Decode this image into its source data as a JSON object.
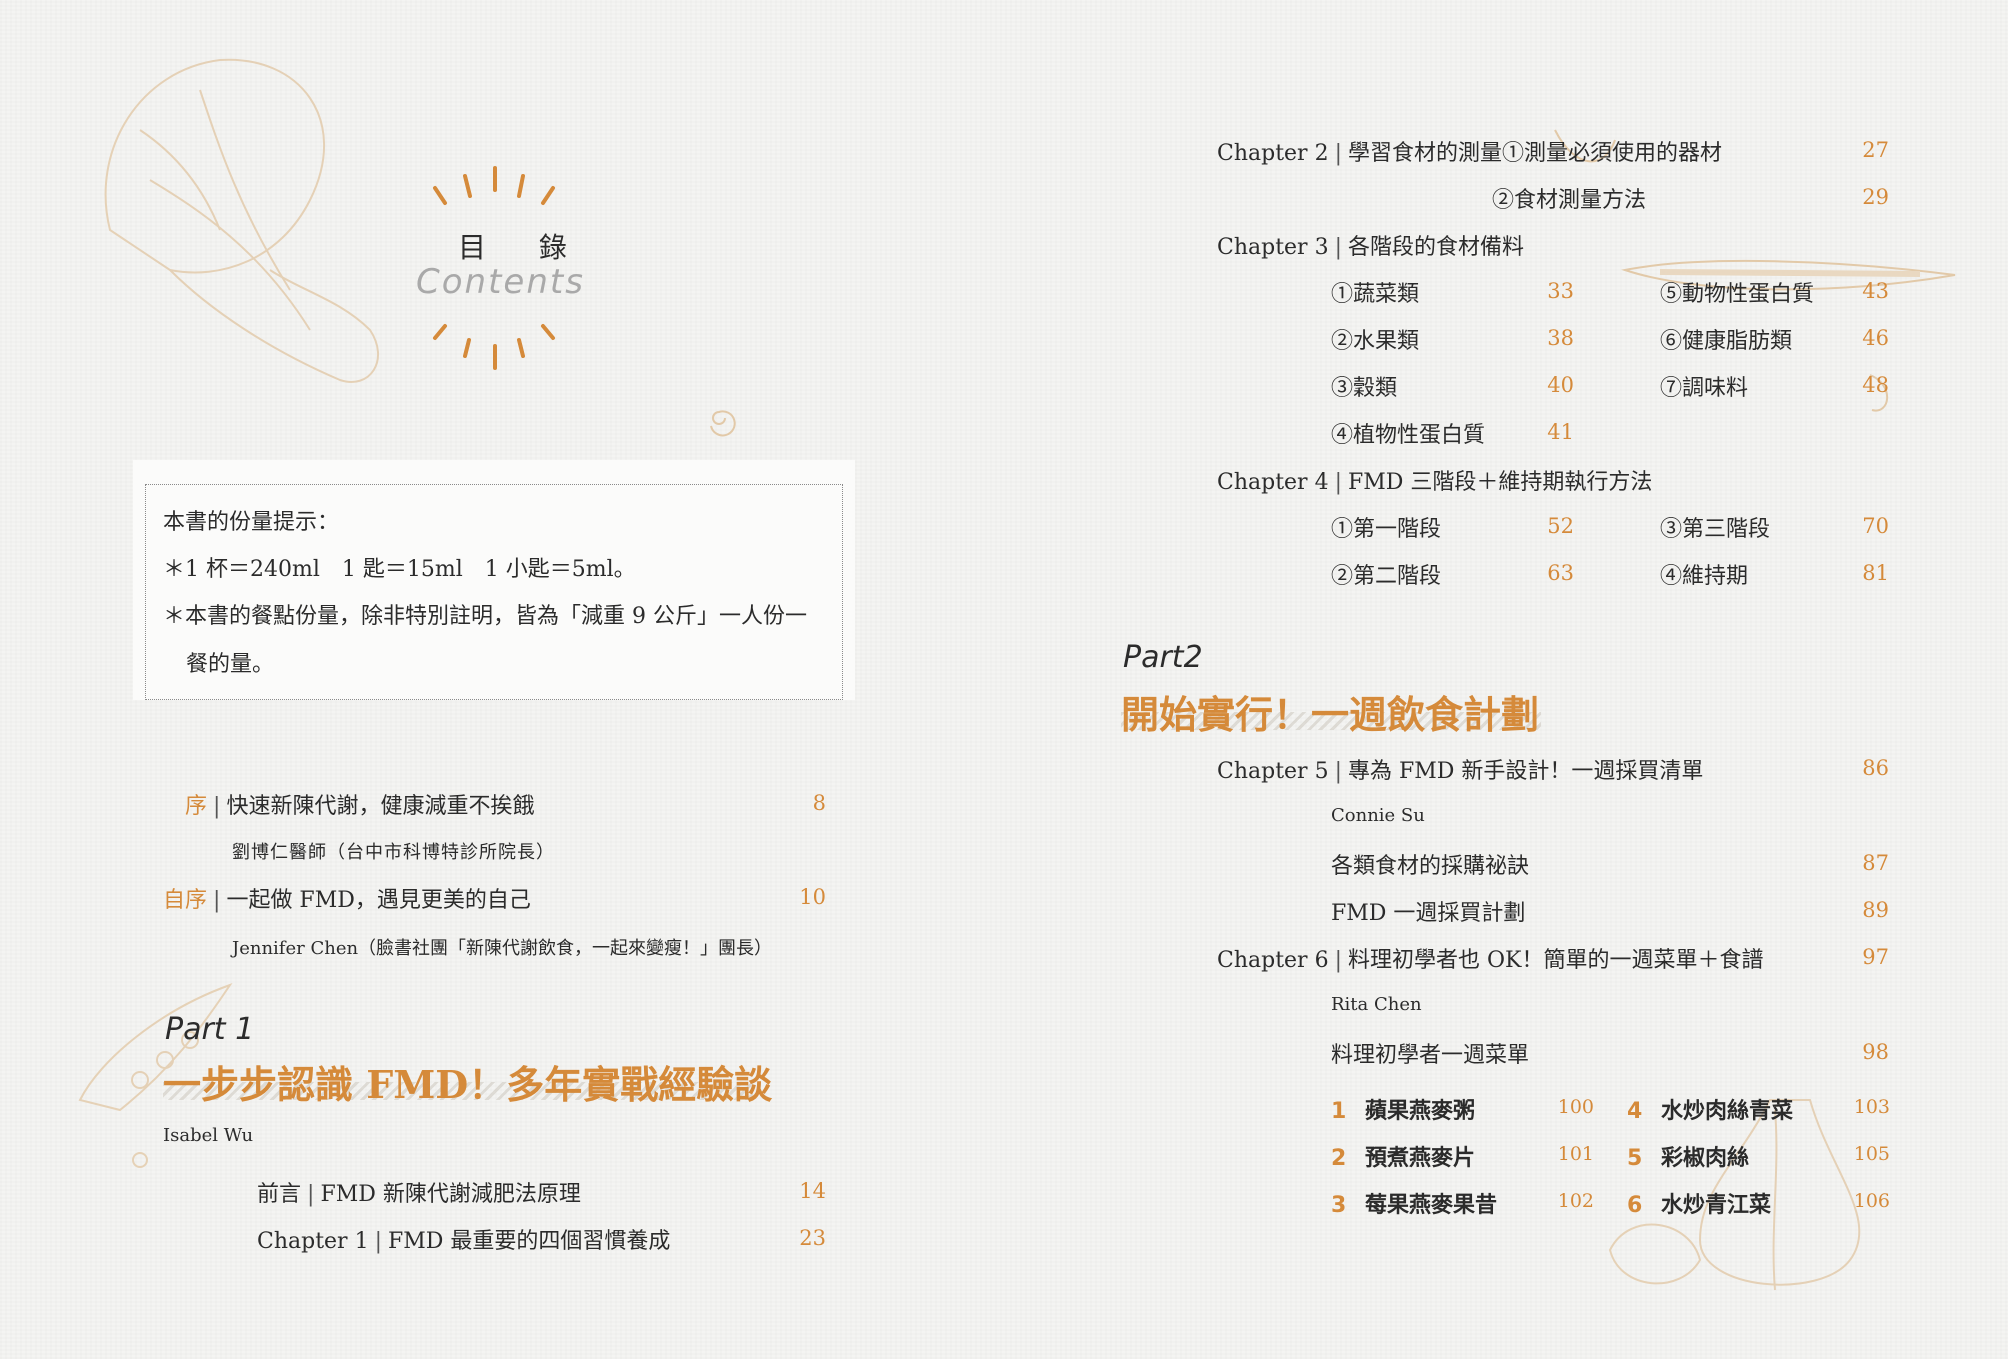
{
  "heading": {
    "zh": "目 錄",
    "en": "Contents"
  },
  "note": {
    "title": "本書的份量提示：",
    "line1": "＊1 杯＝240ml　1 匙＝15ml　1 小匙＝5ml。",
    "line2": "＊本書的餐點份量，除非特別註明，皆為「減重 9 公斤」一人份一",
    "line3": "餐的量。"
  },
  "preface": {
    "label1": "序",
    "title1": "快速新陳代謝，健康減重不挨餓",
    "page1": "8",
    "author1": "劉博仁醫師（台中市科博特診所院長）",
    "label2": "自序",
    "title2": "一起做 FMD，遇見更美的自己",
    "page2": "10",
    "author2": "Jennifer Chen（臉書社團「新陳代謝飲食，一起來變瘦！」團長）"
  },
  "part1": {
    "label": "Part 1",
    "title": "一步步認識 FMD！多年實戰經驗談",
    "author": "Isabel Wu",
    "items": [
      {
        "label": "前言",
        "title": "FMD 新陳代謝減肥法原理",
        "page": "14"
      },
      {
        "label": "Chapter 1",
        "title": "FMD 最重要的四個習慣養成",
        "page": "23"
      }
    ]
  },
  "ch2": {
    "label": "Chapter 2",
    "title": "學習食材的測量①測量必須使用的器材",
    "page": "27",
    "sub": "②食材測量方法",
    "sub_page": "29"
  },
  "ch3": {
    "label": "Chapter 3",
    "title": "各階段的食材備料",
    "left": [
      {
        "t": "①蔬菜類",
        "p": "33"
      },
      {
        "t": "②水果類",
        "p": "38"
      },
      {
        "t": "③穀類",
        "p": "40"
      },
      {
        "t": "④植物性蛋白質",
        "p": "41"
      }
    ],
    "right": [
      {
        "t": "⑤動物性蛋白質",
        "p": "43"
      },
      {
        "t": "⑥健康脂肪類",
        "p": "46"
      },
      {
        "t": "⑦調味料",
        "p": "48"
      }
    ]
  },
  "ch4": {
    "label": "Chapter 4",
    "title": "FMD 三階段＋維持期執行方法",
    "left": [
      {
        "t": "①第一階段",
        "p": "52"
      },
      {
        "t": "②第二階段",
        "p": "63"
      }
    ],
    "right": [
      {
        "t": "③第三階段",
        "p": "70"
      },
      {
        "t": "④維持期",
        "p": "81"
      }
    ]
  },
  "part2": {
    "label": "Part2",
    "title": "開始實行！一週飲食計劃"
  },
  "ch5": {
    "label": "Chapter 5",
    "title": "專為 FMD 新手設計！一週採買清單",
    "page": "86",
    "author": "Connie Su",
    "items": [
      {
        "t": "各類食材的採購祕訣",
        "p": "87"
      },
      {
        "t": "FMD 一週採買計劃",
        "p": "89"
      }
    ]
  },
  "ch6": {
    "label": "Chapter 6",
    "title": "料理初學者也 OK！簡單的一週菜單＋食譜",
    "page": "97",
    "author": "Rita Chen",
    "sub": "料理初學者一週菜單",
    "sub_page": "98",
    "recipes": [
      {
        "n": "1",
        "t": "蘋果燕麥粥",
        "p": "100"
      },
      {
        "n": "2",
        "t": "預煮燕麥片",
        "p": "101"
      },
      {
        "n": "3",
        "t": "莓果燕麥果昔",
        "p": "102"
      },
      {
        "n": "4",
        "t": "水炒肉絲青菜",
        "p": "103"
      },
      {
        "n": "5",
        "t": "彩椒肉絲",
        "p": "105"
      },
      {
        "n": "6",
        "t": "水炒青江菜",
        "p": "106"
      }
    ]
  },
  "colors": {
    "accent": "#d58a3a",
    "text": "#2b2b2b",
    "paper": "#f4f4f2"
  }
}
